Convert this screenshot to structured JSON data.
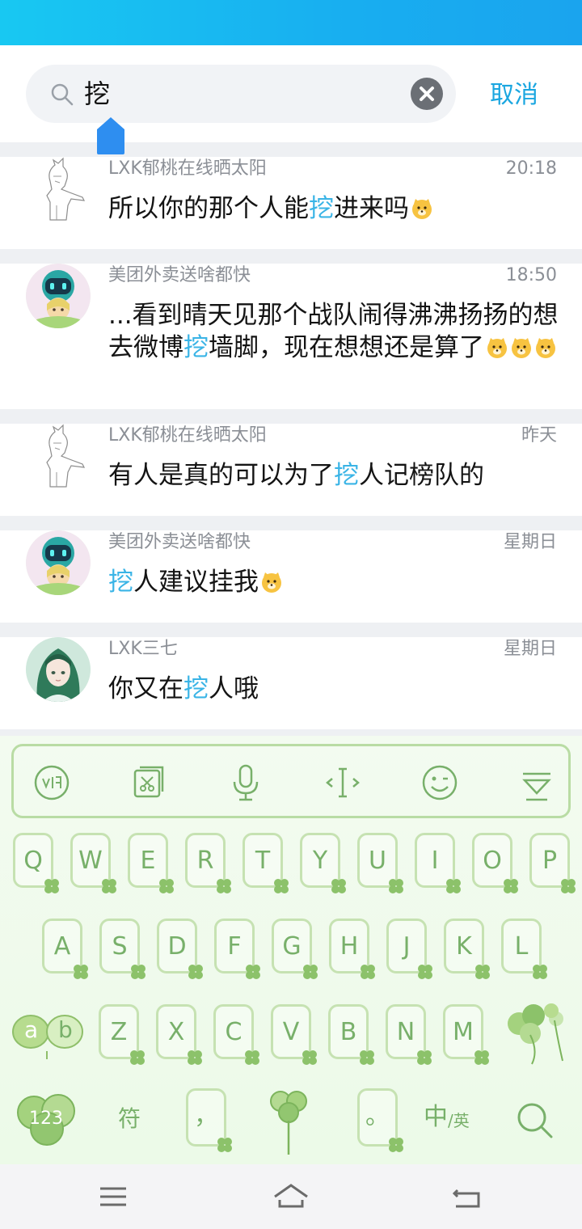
{
  "search": {
    "query": "挖",
    "cancel_label": "取消"
  },
  "results": [
    {
      "name": "LXK郁桃在线晒太阳",
      "time": "20:18",
      "msg_before": "所以你的那个人能",
      "msg_highlight": "挖",
      "msg_after": "进来吗",
      "emojis": 1
    },
    {
      "name": "美团外卖送啥都快",
      "time": "18:50",
      "msg_before": "...看到晴天见那个战队闹得沸沸扬扬的想去微博",
      "msg_highlight": "挖",
      "msg_after": "墙脚，现在想想还是算了",
      "emojis": 3
    },
    {
      "name": "LXK郁桃在线晒太阳",
      "time": "昨天",
      "msg_before": "有人是真的可以为了",
      "msg_highlight": "挖",
      "msg_after": "人记榜队的",
      "emojis": 0
    },
    {
      "name": "美团外卖送啥都快",
      "time": "星期日",
      "msg_before": "",
      "msg_highlight": "挖",
      "msg_after": "人建议挂我",
      "emojis": 1
    },
    {
      "name": "LXK三七",
      "time": "星期日",
      "msg_before": "你又在",
      "msg_highlight": "挖",
      "msg_after": "人哦",
      "emojis": 0
    }
  ],
  "keyboard": {
    "toolbar_icons": [
      "voice-input-icon",
      "clipboard-icon",
      "microphone-icon",
      "cursor-move-icon",
      "emoji-icon",
      "hide-keyboard-icon"
    ],
    "row1": [
      "Q",
      "W",
      "E",
      "R",
      "T",
      "Y",
      "U",
      "I",
      "O",
      "P"
    ],
    "row2": [
      "A",
      "S",
      "D",
      "F",
      "G",
      "H",
      "J",
      "K",
      "L"
    ],
    "row3": [
      "Z",
      "X",
      "C",
      "V",
      "B",
      "N",
      "M"
    ],
    "shift_label_a": "a",
    "shift_label_b": "b",
    "num_label": "123",
    "symbol_label": "符",
    "comma_label": "，",
    "period_label": "。",
    "lang_zh": "中",
    "lang_en": "/英"
  },
  "colors": {
    "accent": "#1aa6e0",
    "highlight": "#3ab4e6",
    "keyboard_green": "#78b06a"
  },
  "nav": {
    "icons": [
      "menu-icon",
      "home-icon",
      "back-icon"
    ]
  }
}
